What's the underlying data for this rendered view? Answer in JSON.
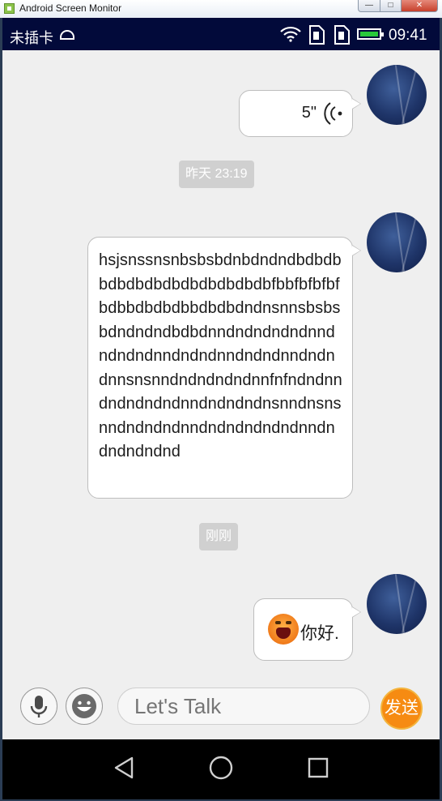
{
  "window": {
    "title": "Android Screen Monitor"
  },
  "status_bar": {
    "carrier": "未插卡",
    "time": "09:41",
    "battery_color": "#28c93a"
  },
  "chat": {
    "messages": [
      {
        "type": "voice",
        "duration": "5\""
      },
      {
        "type": "timestamp",
        "text": "昨天 23:19"
      },
      {
        "type": "text",
        "text": "hsjsnssnsnbsbsbdnbdndndbdbdbbdbdbdbdbdbdbdbdbdbfbbfbfbfbfbdbbdbdbdbbdbdbdndnsnnsbsbsbdndndndbdbdnndndndndndnndndndndnndndndnndndndnndndndnnsnsnndndndndndnnfnfndndnndndndndndnndndndndnsnndnsnsnndndndndnndndndndndndnndndndndndnd"
      },
      {
        "type": "timestamp",
        "text": "刚刚"
      },
      {
        "type": "emoji",
        "text": "你好."
      }
    ]
  },
  "input_bar": {
    "placeholder": "Let's Talk",
    "send_label": "发送",
    "send_color": "#f68b12"
  },
  "nav_bar": {
    "icons": [
      "back-icon",
      "home-icon",
      "recents-icon"
    ]
  }
}
